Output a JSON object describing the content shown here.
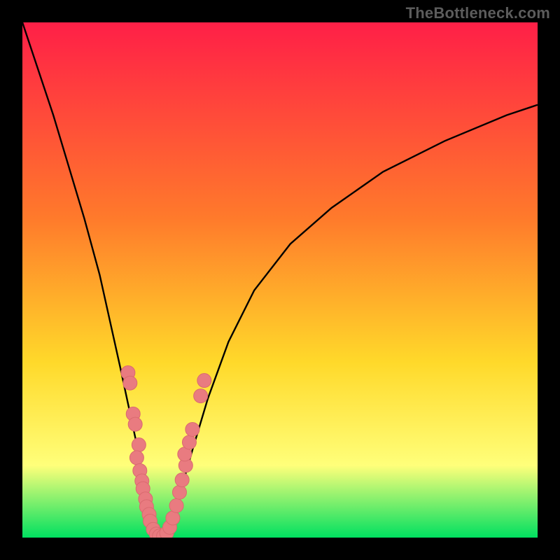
{
  "watermark": "TheBottleneck.com",
  "colors": {
    "frame": "#000000",
    "gradient_top": "#ff1f47",
    "gradient_mid1": "#ff7a2b",
    "gradient_mid2": "#ffd92a",
    "gradient_mid3": "#ffff7a",
    "gradient_bottom": "#00e060",
    "curve": "#000000",
    "marker_fill": "#e97b80",
    "marker_stroke": "#da6a6f"
  },
  "chart_data": {
    "type": "line",
    "title": "",
    "xlabel": "",
    "ylabel": "",
    "xlim": [
      0,
      100
    ],
    "ylim": [
      0,
      100
    ],
    "grid": false,
    "legend": false,
    "series": [
      {
        "name": "left-branch",
        "x": [
          0,
          3,
          6,
          9,
          12,
          15,
          17,
          19,
          20.5,
          22,
          23,
          24,
          24.8,
          25.5,
          26.2,
          27
        ],
        "y": [
          100,
          91,
          82,
          72,
          62,
          51,
          42,
          33,
          26,
          19,
          13,
          8,
          4.5,
          2,
          0.6,
          0
        ]
      },
      {
        "name": "right-branch",
        "x": [
          27,
          28,
          29.5,
          31,
          33,
          36,
          40,
          45,
          52,
          60,
          70,
          82,
          94,
          100
        ],
        "y": [
          0,
          1.5,
          5,
          10,
          17,
          27,
          38,
          48,
          57,
          64,
          71,
          77,
          82,
          84
        ]
      }
    ],
    "markers": [
      {
        "x": 20.5,
        "y": 32
      },
      {
        "x": 20.9,
        "y": 30
      },
      {
        "x": 21.5,
        "y": 24
      },
      {
        "x": 21.9,
        "y": 22
      },
      {
        "x": 22.6,
        "y": 18
      },
      {
        "x": 22.2,
        "y": 15.5
      },
      {
        "x": 22.8,
        "y": 13
      },
      {
        "x": 23.2,
        "y": 11
      },
      {
        "x": 23.4,
        "y": 9.5
      },
      {
        "x": 23.9,
        "y": 7.5
      },
      {
        "x": 24.1,
        "y": 6
      },
      {
        "x": 24.6,
        "y": 4.5
      },
      {
        "x": 24.8,
        "y": 3.2
      },
      {
        "x": 25.4,
        "y": 1.6
      },
      {
        "x": 26.0,
        "y": 0.7
      },
      {
        "x": 26.6,
        "y": 0.3
      },
      {
        "x": 27.4,
        "y": 0.3
      },
      {
        "x": 28.0,
        "y": 0.9
      },
      {
        "x": 28.6,
        "y": 2.0
      },
      {
        "x": 29.2,
        "y": 3.8
      },
      {
        "x": 29.9,
        "y": 6.2
      },
      {
        "x": 30.5,
        "y": 8.8
      },
      {
        "x": 31.0,
        "y": 11.2
      },
      {
        "x": 31.7,
        "y": 14.0
      },
      {
        "x": 31.5,
        "y": 16.2
      },
      {
        "x": 32.4,
        "y": 18.5
      },
      {
        "x": 33.0,
        "y": 21.0
      },
      {
        "x": 34.6,
        "y": 27.5
      },
      {
        "x": 35.3,
        "y": 30.5
      }
    ],
    "marker_radius": 10
  }
}
